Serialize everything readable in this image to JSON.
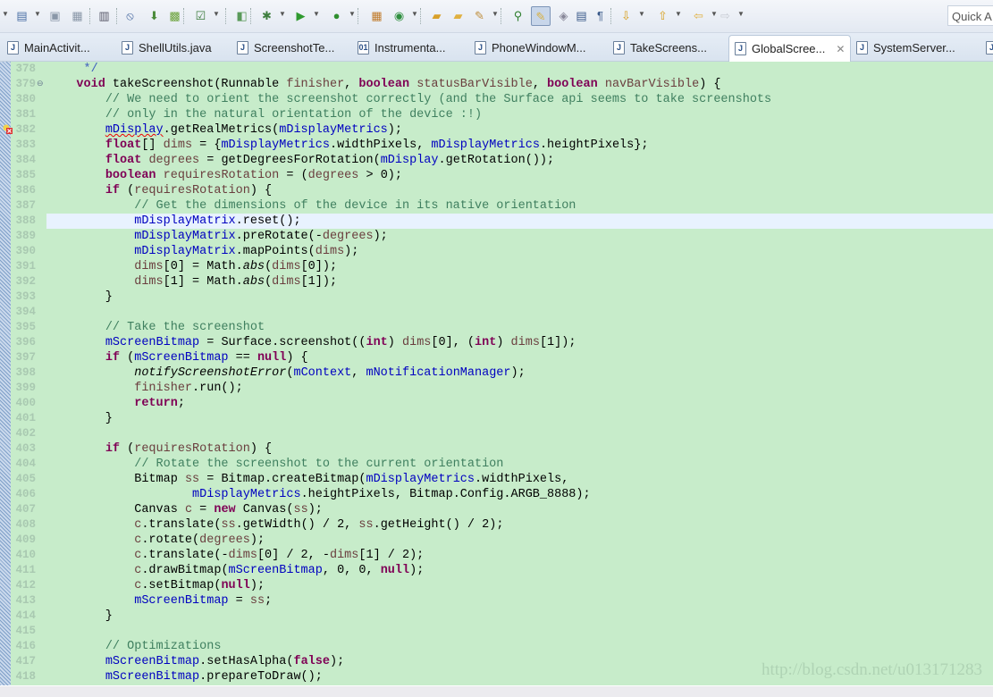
{
  "toolbar": {
    "icons": [
      "new-icon",
      "save-icon",
      "save-all-icon",
      "binary-icon",
      "skip-breakpoints-icon",
      "android-sdk-icon",
      "android-avd-icon",
      "task-icon",
      "new-class-icon",
      "debug-icon",
      "run-icon",
      "external-tools-icon",
      "new-package-icon",
      "new-java-class-icon",
      "open-type-icon",
      "open-folder-icon",
      "search-brush-icon",
      "open-task-icon",
      "mark-occurrences-icon",
      "block-selection-icon",
      "show-whitespace-icon",
      "next-annotation-icon",
      "previous-annotation-icon",
      "last-edit-icon",
      "back-icon",
      "forward-icon"
    ],
    "quick_access": "Quick A"
  },
  "tabs": [
    {
      "label": "MainActivit...",
      "active": false
    },
    {
      "label": "ShellUtils.java",
      "active": false
    },
    {
      "label": "ScreenshotTe...",
      "active": false
    },
    {
      "label": "Instrumenta...",
      "active": false
    },
    {
      "label": "PhoneWindowM...",
      "active": false
    },
    {
      "label": "TakeScreens...",
      "active": false
    },
    {
      "label": "GlobalScree...",
      "active": true
    },
    {
      "label": "SystemServer...",
      "active": false
    },
    {
      "label": "",
      "active": false
    }
  ],
  "tab_close_glyph": "✕",
  "colors": {
    "editor_bg": "#c7ecca",
    "keyword": "#7f0055",
    "field": "#0000c0",
    "comment": "#3f7f5f",
    "local": "#6a3e3e",
    "current_line": "#e8f2fe"
  },
  "editor": {
    "highlighted_line": "388",
    "error_line": "382",
    "lines": [
      {
        "n": "378",
        "t": [
          [
            "     */",
            "d"
          ]
        ]
      },
      {
        "n": "379",
        "fold": true,
        "t": [
          [
            "    ",
            "p"
          ],
          [
            "void",
            "k"
          ],
          [
            " takeScreenshot(Runnable ",
            "p"
          ],
          [
            "finisher",
            "v"
          ],
          [
            ", ",
            "p"
          ],
          [
            "boolean",
            "k"
          ],
          [
            " ",
            "p"
          ],
          [
            "statusBarVisible",
            "v"
          ],
          [
            ", ",
            "p"
          ],
          [
            "boolean",
            "k"
          ],
          [
            " ",
            "p"
          ],
          [
            "navBarVisible",
            "v"
          ],
          [
            ") {",
            "p"
          ]
        ]
      },
      {
        "n": "380",
        "t": [
          [
            "        ",
            "p"
          ],
          [
            "// We need to orient the screenshot correctly (and the Surface api seems to take screenshots",
            "c"
          ]
        ]
      },
      {
        "n": "381",
        "t": [
          [
            "        ",
            "p"
          ],
          [
            "// only in the natural orientation of the device :!)",
            "c"
          ]
        ]
      },
      {
        "n": "382",
        "t": [
          [
            "        ",
            "p"
          ],
          [
            "mDisplay",
            "e"
          ],
          [
            ".getRealMetrics(",
            "p"
          ],
          [
            "mDisplayMetrics",
            "f"
          ],
          [
            ");",
            "p"
          ]
        ]
      },
      {
        "n": "383",
        "t": [
          [
            "        ",
            "p"
          ],
          [
            "float",
            "k"
          ],
          [
            "[] ",
            "p"
          ],
          [
            "dims",
            "v"
          ],
          [
            " = {",
            "p"
          ],
          [
            "mDisplayMetrics",
            "f"
          ],
          [
            ".widthPixels, ",
            "p"
          ],
          [
            "mDisplayMetrics",
            "f"
          ],
          [
            ".heightPixels};",
            "p"
          ]
        ]
      },
      {
        "n": "384",
        "t": [
          [
            "        ",
            "p"
          ],
          [
            "float",
            "k"
          ],
          [
            " ",
            "p"
          ],
          [
            "degrees",
            "v"
          ],
          [
            " = getDegreesForRotation(",
            "p"
          ],
          [
            "mDisplay",
            "f"
          ],
          [
            ".getRotation());",
            "p"
          ]
        ]
      },
      {
        "n": "385",
        "t": [
          [
            "        ",
            "p"
          ],
          [
            "boolean",
            "k"
          ],
          [
            " ",
            "p"
          ],
          [
            "requiresRotation",
            "v"
          ],
          [
            " = (",
            "p"
          ],
          [
            "degrees",
            "v"
          ],
          [
            " > 0);",
            "p"
          ]
        ]
      },
      {
        "n": "386",
        "t": [
          [
            "        ",
            "p"
          ],
          [
            "if",
            "k"
          ],
          [
            " (",
            "p"
          ],
          [
            "requiresRotation",
            "v"
          ],
          [
            ") {",
            "p"
          ]
        ]
      },
      {
        "n": "387",
        "t": [
          [
            "            ",
            "p"
          ],
          [
            "// Get the dimensions of the device in its native orientation",
            "c"
          ]
        ]
      },
      {
        "n": "388",
        "t": [
          [
            "            ",
            "p"
          ],
          [
            "mDisplayMatrix",
            "f"
          ],
          [
            ".reset();",
            "p"
          ]
        ]
      },
      {
        "n": "389",
        "t": [
          [
            "            ",
            "p"
          ],
          [
            "mDisplayMatrix",
            "f"
          ],
          [
            ".preRotate(-",
            "p"
          ],
          [
            "degrees",
            "v"
          ],
          [
            ");",
            "p"
          ]
        ]
      },
      {
        "n": "390",
        "t": [
          [
            "            ",
            "p"
          ],
          [
            "mDisplayMatrix",
            "f"
          ],
          [
            ".mapPoints(",
            "p"
          ],
          [
            "dims",
            "v"
          ],
          [
            ");",
            "p"
          ]
        ]
      },
      {
        "n": "391",
        "t": [
          [
            "            ",
            "p"
          ],
          [
            "dims",
            "v"
          ],
          [
            "[0] = Math.",
            "p"
          ],
          [
            "abs",
            "i"
          ],
          [
            "(",
            "p"
          ],
          [
            "dims",
            "v"
          ],
          [
            "[0]);",
            "p"
          ]
        ]
      },
      {
        "n": "392",
        "t": [
          [
            "            ",
            "p"
          ],
          [
            "dims",
            "v"
          ],
          [
            "[1] = Math.",
            "p"
          ],
          [
            "abs",
            "i"
          ],
          [
            "(",
            "p"
          ],
          [
            "dims",
            "v"
          ],
          [
            "[1]);",
            "p"
          ]
        ]
      },
      {
        "n": "393",
        "t": [
          [
            "        }",
            "p"
          ]
        ]
      },
      {
        "n": "394",
        "t": []
      },
      {
        "n": "395",
        "t": [
          [
            "        ",
            "p"
          ],
          [
            "// Take the screenshot",
            "c"
          ]
        ]
      },
      {
        "n": "396",
        "t": [
          [
            "        ",
            "p"
          ],
          [
            "mScreenBitmap",
            "f"
          ],
          [
            " = Surface.screenshot((",
            "p"
          ],
          [
            "int",
            "k"
          ],
          [
            ") ",
            "p"
          ],
          [
            "dims",
            "v"
          ],
          [
            "[0], (",
            "p"
          ],
          [
            "int",
            "k"
          ],
          [
            ") ",
            "p"
          ],
          [
            "dims",
            "v"
          ],
          [
            "[1]);",
            "p"
          ]
        ]
      },
      {
        "n": "397",
        "t": [
          [
            "        ",
            "p"
          ],
          [
            "if",
            "k"
          ],
          [
            " (",
            "p"
          ],
          [
            "mScreenBitmap",
            "f"
          ],
          [
            " == ",
            "p"
          ],
          [
            "null",
            "k"
          ],
          [
            ") {",
            "p"
          ]
        ]
      },
      {
        "n": "398",
        "t": [
          [
            "            ",
            "p"
          ],
          [
            "notifyScreenshotError",
            "i"
          ],
          [
            "(",
            "p"
          ],
          [
            "mContext",
            "f"
          ],
          [
            ", ",
            "p"
          ],
          [
            "mNotificationManager",
            "f"
          ],
          [
            ");",
            "p"
          ]
        ]
      },
      {
        "n": "399",
        "t": [
          [
            "            ",
            "p"
          ],
          [
            "finisher",
            "v"
          ],
          [
            ".run();",
            "p"
          ]
        ]
      },
      {
        "n": "400",
        "t": [
          [
            "            ",
            "p"
          ],
          [
            "return",
            "k"
          ],
          [
            ";",
            "p"
          ]
        ]
      },
      {
        "n": "401",
        "t": [
          [
            "        }",
            "p"
          ]
        ]
      },
      {
        "n": "402",
        "t": []
      },
      {
        "n": "403",
        "t": [
          [
            "        ",
            "p"
          ],
          [
            "if",
            "k"
          ],
          [
            " (",
            "p"
          ],
          [
            "requiresRotation",
            "v"
          ],
          [
            ") {",
            "p"
          ]
        ]
      },
      {
        "n": "404",
        "t": [
          [
            "            ",
            "p"
          ],
          [
            "// Rotate the screenshot to the current orientation",
            "c"
          ]
        ]
      },
      {
        "n": "405",
        "t": [
          [
            "            Bitmap ",
            "p"
          ],
          [
            "ss",
            "v"
          ],
          [
            " = Bitmap.createBitmap(",
            "p"
          ],
          [
            "mDisplayMetrics",
            "f"
          ],
          [
            ".widthPixels,",
            "p"
          ]
        ]
      },
      {
        "n": "406",
        "t": [
          [
            "                    ",
            "p"
          ],
          [
            "mDisplayMetrics",
            "f"
          ],
          [
            ".heightPixels, Bitmap.Config.ARGB_8888);",
            "p"
          ]
        ]
      },
      {
        "n": "407",
        "t": [
          [
            "            Canvas ",
            "p"
          ],
          [
            "c",
            "v"
          ],
          [
            " = ",
            "p"
          ],
          [
            "new",
            "k"
          ],
          [
            " Canvas(",
            "p"
          ],
          [
            "ss",
            "v"
          ],
          [
            ");",
            "p"
          ]
        ]
      },
      {
        "n": "408",
        "t": [
          [
            "            ",
            "p"
          ],
          [
            "c",
            "v"
          ],
          [
            ".translate(",
            "p"
          ],
          [
            "ss",
            "v"
          ],
          [
            ".getWidth() / 2, ",
            "p"
          ],
          [
            "ss",
            "v"
          ],
          [
            ".getHeight() / 2);",
            "p"
          ]
        ]
      },
      {
        "n": "409",
        "t": [
          [
            "            ",
            "p"
          ],
          [
            "c",
            "v"
          ],
          [
            ".rotate(",
            "p"
          ],
          [
            "degrees",
            "v"
          ],
          [
            ");",
            "p"
          ]
        ]
      },
      {
        "n": "410",
        "t": [
          [
            "            ",
            "p"
          ],
          [
            "c",
            "v"
          ],
          [
            ".translate(-",
            "p"
          ],
          [
            "dims",
            "v"
          ],
          [
            "[0] / 2, -",
            "p"
          ],
          [
            "dims",
            "v"
          ],
          [
            "[1] / 2);",
            "p"
          ]
        ]
      },
      {
        "n": "411",
        "t": [
          [
            "            ",
            "p"
          ],
          [
            "c",
            "v"
          ],
          [
            ".drawBitmap(",
            "p"
          ],
          [
            "mScreenBitmap",
            "f"
          ],
          [
            ", 0, 0, ",
            "p"
          ],
          [
            "null",
            "k"
          ],
          [
            ");",
            "p"
          ]
        ]
      },
      {
        "n": "412",
        "t": [
          [
            "            ",
            "p"
          ],
          [
            "c",
            "v"
          ],
          [
            ".setBitmap(",
            "p"
          ],
          [
            "null",
            "k"
          ],
          [
            ");",
            "p"
          ]
        ]
      },
      {
        "n": "413",
        "t": [
          [
            "            ",
            "p"
          ],
          [
            "mScreenBitmap",
            "f"
          ],
          [
            " = ",
            "p"
          ],
          [
            "ss",
            "v"
          ],
          [
            ";",
            "p"
          ]
        ]
      },
      {
        "n": "414",
        "t": [
          [
            "        }",
            "p"
          ]
        ]
      },
      {
        "n": "415",
        "t": []
      },
      {
        "n": "416",
        "t": [
          [
            "        ",
            "p"
          ],
          [
            "// Optimizations",
            "c"
          ]
        ]
      },
      {
        "n": "417",
        "t": [
          [
            "        ",
            "p"
          ],
          [
            "mScreenBitmap",
            "f"
          ],
          [
            ".setHasAlpha(",
            "p"
          ],
          [
            "false",
            "k"
          ],
          [
            ");",
            "p"
          ]
        ]
      },
      {
        "n": "418",
        "t": [
          [
            "        ",
            "p"
          ],
          [
            "mScreenBitmap",
            "f"
          ],
          [
            ".prepareToDraw();",
            "p"
          ]
        ]
      }
    ]
  },
  "watermark": "http://blog.csdn.net/u013171283"
}
